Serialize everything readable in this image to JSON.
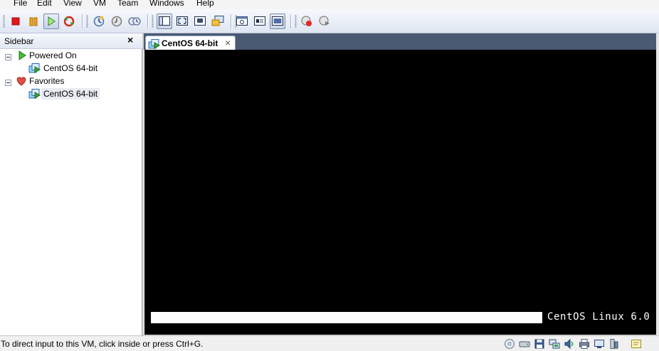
{
  "menu": {
    "items": [
      "File",
      "Edit",
      "View",
      "VM",
      "Team",
      "Windows",
      "Help"
    ]
  },
  "toolbar": {
    "buttons": [
      "stop-icon",
      "pause-icon",
      "play-icon",
      "reset-icon",
      "snapshot-icon",
      "revert-snapshot-icon",
      "snapshot-manager-icon",
      "quick-switch-icon",
      "full-screen-icon",
      "unity-icon",
      "console-view-icon",
      "settings-icon",
      "summary-icon",
      "console-icon",
      "record-icon",
      "replay-icon"
    ]
  },
  "sidebar": {
    "title": "Sidebar",
    "close_label": "×",
    "groups": [
      {
        "label": "Powered On",
        "icon": "powered-on-icon",
        "items": [
          {
            "label": "CentOS 64-bit",
            "selected": false
          }
        ]
      },
      {
        "label": "Favorites",
        "icon": "heart-icon",
        "items": [
          {
            "label": "CentOS 64-bit",
            "selected": true
          }
        ]
      }
    ]
  },
  "tabs": [
    {
      "label": "CentOS 64-bit",
      "close_label": "×",
      "active": true
    }
  ],
  "console": {
    "brand": "CentOS Linux 6.0",
    "boot_progress": 1.0
  },
  "status": {
    "message": "To direct input to this VM, click inside or press Ctrl+G.",
    "devices": [
      "cdrom-icon",
      "hard-disk-icon",
      "floppy-icon",
      "network-icon",
      "sound-icon",
      "printer-icon",
      "display-icon",
      "usb-icon",
      "messages-icon"
    ]
  },
  "colors": {
    "toolbar_bg": "#e4eaf4",
    "tab_strip": "#4b5a73",
    "console_bg": "#000000",
    "vm_icon_green": "#3aa63a"
  }
}
